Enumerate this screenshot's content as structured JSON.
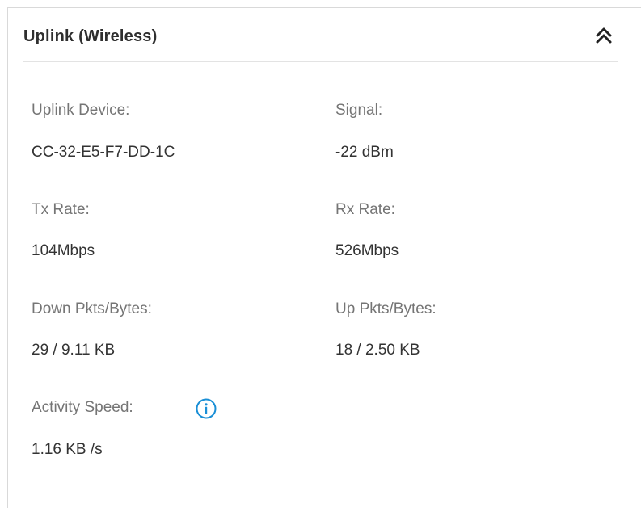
{
  "panel": {
    "title": "Uplink (Wireless)",
    "collapse_icon": "double-chevron-up-icon"
  },
  "fields": {
    "uplink_device": {
      "label": "Uplink Device:",
      "value": "CC-32-E5-F7-DD-1C"
    },
    "signal": {
      "label": "Signal:",
      "value": "-22 dBm"
    },
    "tx_rate": {
      "label": "Tx Rate:",
      "value": "104Mbps"
    },
    "rx_rate": {
      "label": "Rx Rate:",
      "value": "526Mbps"
    },
    "down_pkts_bytes": {
      "label": "Down Pkts/Bytes:",
      "value": "29 / 9.11 KB"
    },
    "up_pkts_bytes": {
      "label": "Up Pkts/Bytes:",
      "value": "18 / 2.50 KB"
    },
    "activity_speed": {
      "label": "Activity Speed:",
      "value": "1.16 KB /s",
      "info_icon": "info-circle-icon"
    }
  },
  "colors": {
    "accent": "#1a8fd6",
    "label": "#757575",
    "value": "#333333",
    "border": "#d9d9d9"
  }
}
